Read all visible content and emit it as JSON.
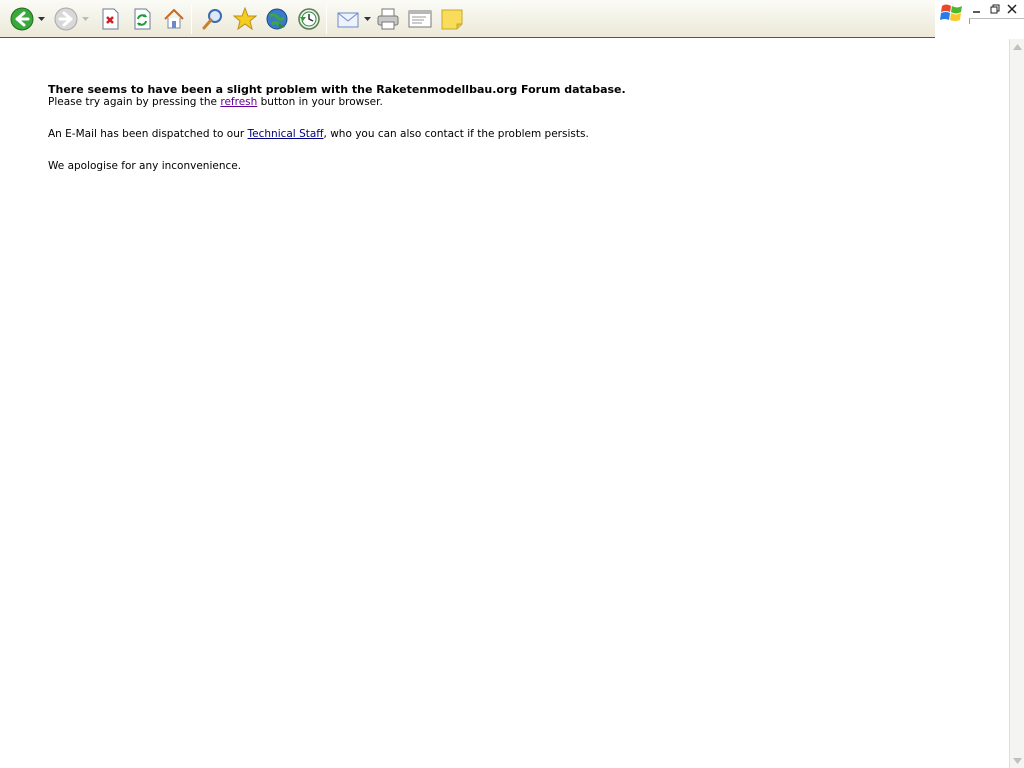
{
  "toolbar": {
    "buttons": [
      {
        "icon": "back-arrow-icon",
        "state": "enabled",
        "color": "#2a9a2a"
      },
      {
        "icon": "forward-arrow-icon",
        "state": "disabled",
        "color": "#b0b0b0"
      },
      {
        "icon": "stop-icon",
        "color": "#cc2222"
      },
      {
        "icon": "refresh-icon",
        "color": "#1f8a3a"
      },
      {
        "icon": "home-icon",
        "color": "#d88a2a"
      },
      {
        "icon": "search-icon",
        "color": "#3a6ab8"
      },
      {
        "icon": "favorites-star-icon",
        "color": "#f0c020"
      },
      {
        "icon": "media-globe-icon",
        "color": "#2a5aa8"
      },
      {
        "icon": "history-icon",
        "color": "#2a8a3a"
      },
      {
        "icon": "mail-icon",
        "color": "#6a8ac8"
      },
      {
        "icon": "print-icon",
        "color": "#888888"
      },
      {
        "icon": "edit-icon",
        "color": "#888888"
      },
      {
        "icon": "discuss-note-icon",
        "color": "#f4d64a"
      }
    ]
  },
  "window_controls": {
    "logo": "windows-flag-icon",
    "minimize": "minimize-icon",
    "restore": "restore-icon",
    "close": "close-icon"
  },
  "content": {
    "title": "There seems to have been a slight problem with the Raketenmodellbau.org Forum database.",
    "line1_before": "Please try again by pressing the ",
    "line1_link": "refresh",
    "line1_after": " button in your browser.",
    "line2_before": "An E-Mail has been dispatched to our ",
    "line2_link": "Technical Staff",
    "line2_after": ", who you can also contact if the problem persists.",
    "line3": "We apologise for any inconvenience."
  }
}
